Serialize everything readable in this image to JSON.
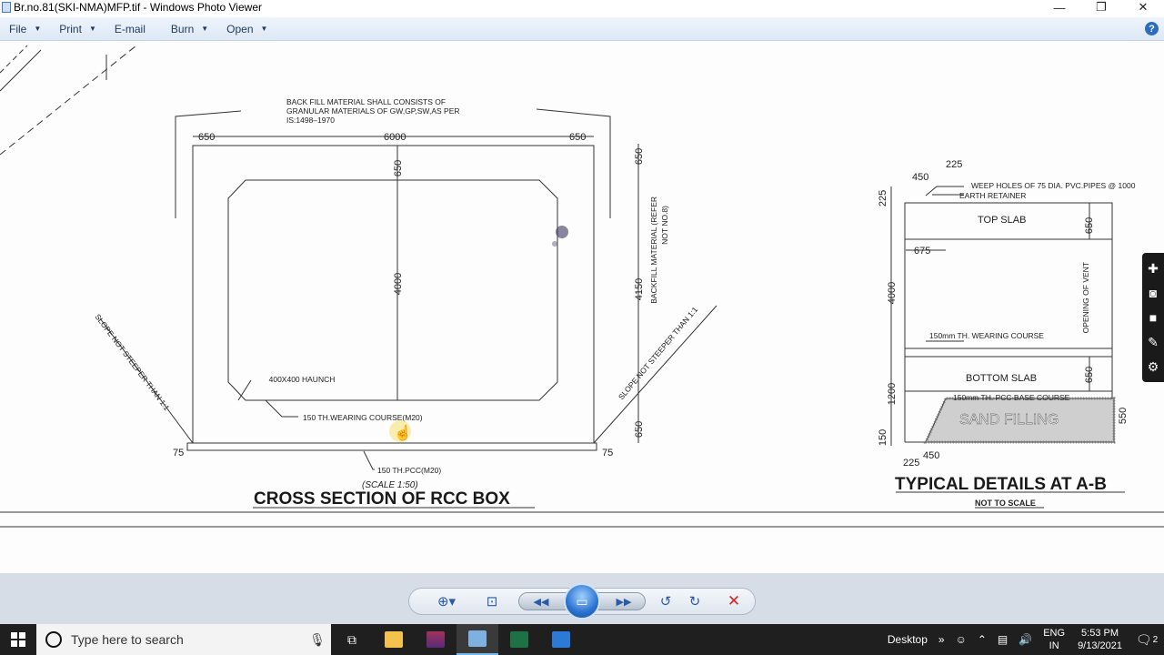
{
  "window": {
    "title": "Br.no.81(SKI-NMA)MFP.tif - Windows Photo Viewer",
    "minimize": "—",
    "restore": "❐",
    "close": "✕"
  },
  "menu": {
    "file": "File",
    "print": "Print",
    "email": "E-mail",
    "burn": "Burn",
    "open": "Open",
    "help": "?"
  },
  "drawing": {
    "backfill_note": [
      "BACK FILL MATERIAL SHALL CONSISTS OF",
      "GRANULAR MATERIALS OF GW,GP,SW,AS PER",
      "IS:1498–1970"
    ],
    "dim_650_left": "650",
    "dim_6000": "6000",
    "dim_650_right": "650",
    "dim_650_top_vert": "650",
    "dim_4000_vert": "4000",
    "dim_650_right_top": "650",
    "dim_4150": "4150",
    "dim_650_right_bottom": "650",
    "backfill_side": [
      "BACKFILL MATERIAL (REFER",
      "NOT NO.8)"
    ],
    "slope_left": "SLOPE NOT STEEPER THAN 1:1",
    "slope_right": "SLOPE NOT STEEPER THAN 1:1",
    "haunch": "400X400 HAUNCH",
    "wearing": "150 TH.WEARING COURSE(M20)",
    "dim_75_left": "75",
    "dim_75_right": "75",
    "pcc": "150 TH.PCC(M20)",
    "scale": "(SCALE 1:50)",
    "title_left": "CROSS SECTION OF RCC BOX",
    "t_225_top": "225",
    "t_450_top": "450",
    "t_225_top_right": "225",
    "weep": "WEEP HOLES OF 75 DIA. PVC.PIPES @ 1000",
    "earth": "EARTH RETAINER",
    "top_slab": "TOP SLAB",
    "t_650_a": "650",
    "t_675": "675",
    "t_4000": "4000",
    "vent": "OPENING OF VENT",
    "wearing_150": "150mm TH. WEARING COURSE",
    "bottom_slab": "BOTTOM SLAB",
    "t_650_b": "650",
    "t_1200": "1200",
    "pcc_base": "150mm TH. PCC BASE COURSE",
    "sand": "SAND FILLING",
    "t_550": "550",
    "t_150": "150",
    "t_225_bottom": "225",
    "t_450_bottom": "450",
    "title_right": "TYPICAL DETAILS AT A-B",
    "not_to_scale": "NOT TO SCALE"
  },
  "taskbar": {
    "search_placeholder": "Type here to search",
    "desktop": "Desktop",
    "lang_1": "ENG",
    "lang_2": "IN",
    "time": "5:53 PM",
    "date": "9/13/2021",
    "notifications": "2"
  }
}
